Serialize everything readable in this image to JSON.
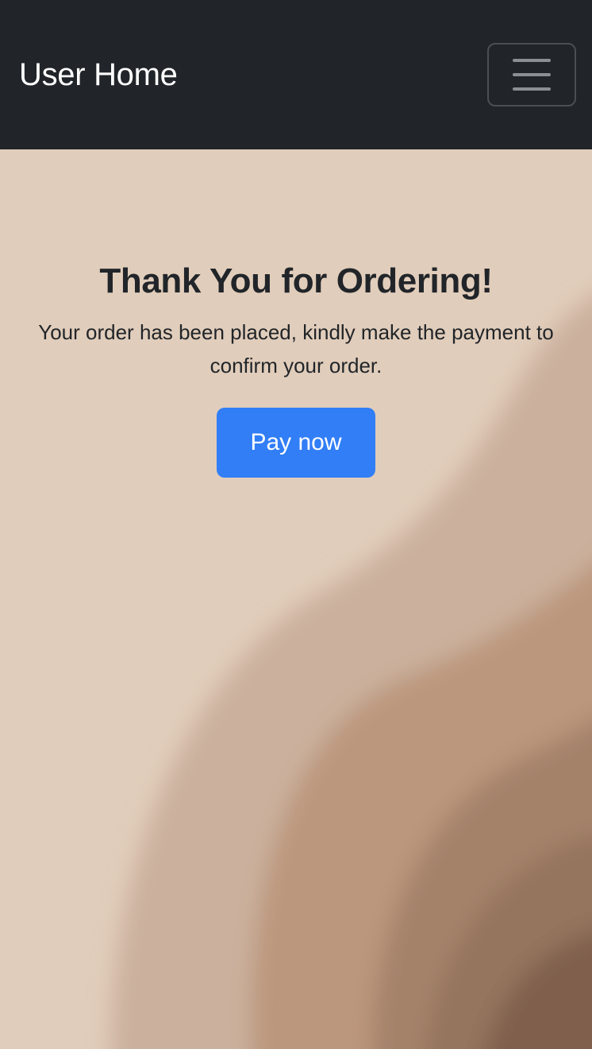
{
  "navbar": {
    "brand": "User Home",
    "toggler_icon": "hamburger-menu-icon",
    "background_color": "#212529"
  },
  "main": {
    "title": "Thank You for Ordering!",
    "message": "Your order has been placed, kindly make the payment to confirm your order.",
    "pay_button_label": "Pay now",
    "accent_color": "#317ef6",
    "background_color": "#e1cdbb"
  }
}
